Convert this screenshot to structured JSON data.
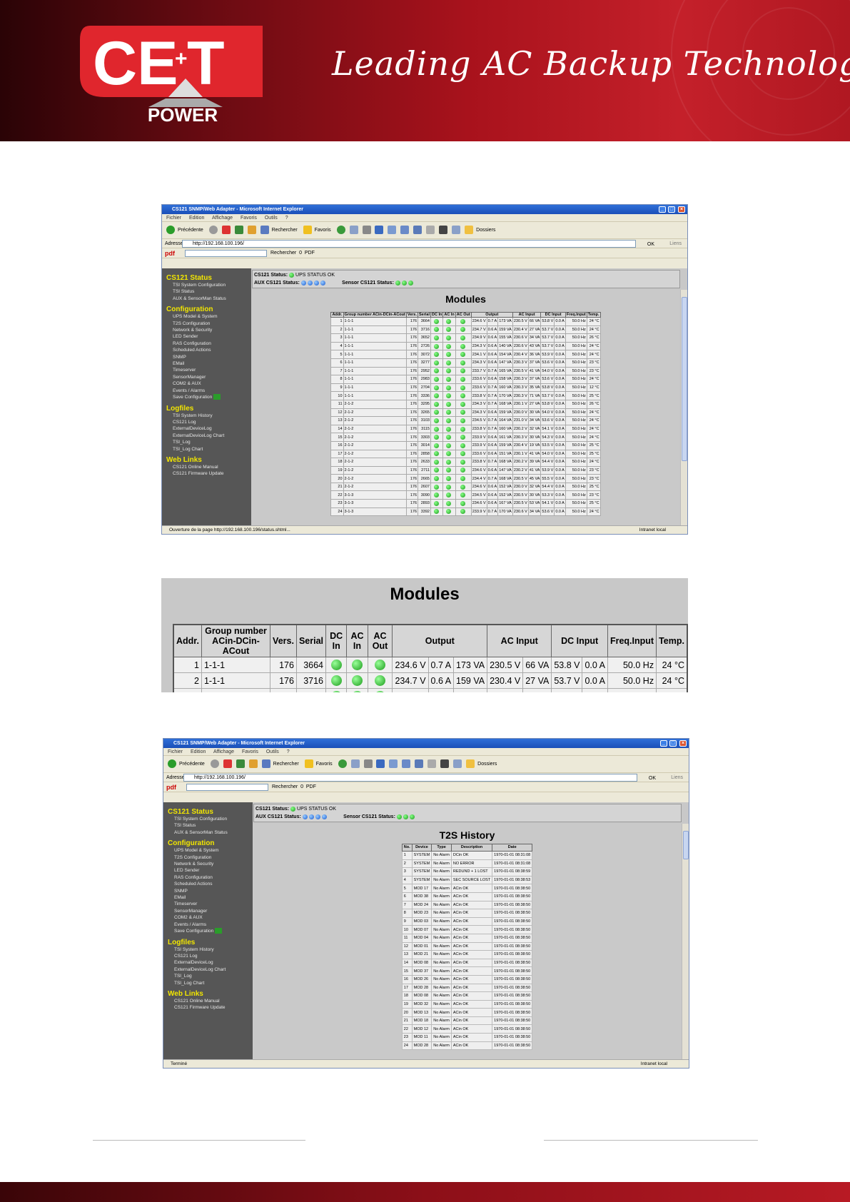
{
  "header": {
    "brand_top": "CE+T",
    "brand_bottom": "POWER",
    "tagline": "Leading AC Backup Technology"
  },
  "browser1": {
    "title": "CS121 SNMP/Web Adapter - Microsoft Internet Explorer",
    "menu": [
      "Fichier",
      "Edition",
      "Affichage",
      "Favoris",
      "Outils",
      "?"
    ],
    "toolbar": {
      "back": "Précédente",
      "search": "Rechercher",
      "favorites": "Favoris",
      "folders": "Dossiers"
    },
    "address_label": "Adresse",
    "address": "http://192.168.100.196/",
    "go": "OK",
    "links": "Liens",
    "pdf_label": "pdf",
    "pdf_search": "Rechercher",
    "pdf_count": "0",
    "pdf_btn": "PDF",
    "status_bar": "Ouverture de la page http://192.168.100.196/status.shtml...",
    "zone": "Intranet local",
    "page_title": "Modules"
  },
  "browser2": {
    "title": "CS121 SNMP/Web Adapter - Microsoft Internet Explorer",
    "address": "http://192.168.100.196/",
    "pdf_count": "0",
    "status_bar": "Terminé",
    "zone": "Intranet local",
    "page_title": "T2S History"
  },
  "cs121_status": {
    "label": "CS121 Status:",
    "value": "UPS STATUS OK",
    "aux_label": "AUX CS121 Status:",
    "sensor_label": "Sensor CS121 Status:"
  },
  "sidebar": {
    "sections": [
      {
        "title": "CS121 Status",
        "items": [
          "TSI System Configuration",
          "TSI Status",
          "AUX & SensorMan Status"
        ]
      },
      {
        "title": "Configuration",
        "items": [
          "UPS Model & System",
          "T2S Configuration",
          "Network & Security",
          "LED Sender",
          "RAS Configuration",
          "Scheduled Actions",
          "SNMP",
          "EMail",
          "Timeserver",
          "SensorManager",
          "COM2 & AUX",
          "Events / Alarms",
          "Save Configuration"
        ]
      },
      {
        "title": "Logfiles",
        "items": [
          "TSI System History",
          "CS121 Log",
          "ExternalDeviceLog",
          "ExternalDeviceLog Chart",
          "TSI_Log",
          "TSI_Log Chart"
        ]
      },
      {
        "title": "Web Links",
        "items": [
          "CS121 Online Manual",
          "CS121 Firmware Update"
        ]
      }
    ]
  },
  "modules": {
    "headers": [
      "Addr.",
      "Group number ACin-DCin-ACout",
      "Vers.",
      "Serial",
      "DC In",
      "AC In",
      "AC Out",
      "Output",
      "AC Input",
      "DC Input",
      "Freq.Input",
      "Temp."
    ],
    "rows": [
      [
        "1",
        "1-1-1",
        "176",
        "3664",
        "234.6 V",
        "0.7 A",
        "173 VA",
        "230.5 V",
        "66 VA",
        "53.8 V",
        "0.0 A",
        "50.0 Hz",
        "24 °C"
      ],
      [
        "2",
        "1-1-1",
        "176",
        "3716",
        "234.7 V",
        "0.6 A",
        "159 VA",
        "230.4 V",
        "27 VA",
        "53.7 V",
        "0.0 A",
        "50.0 Hz",
        "24 °C"
      ],
      [
        "3",
        "1-1-1",
        "176",
        "3652",
        "234.9 V",
        "0.6 A",
        "155 VA",
        "230.6 V",
        "34 VA",
        "53.7 V",
        "0.0 A",
        "50.0 Hz",
        "26 °C"
      ],
      [
        "4",
        "1-1-1",
        "176",
        "2726",
        "234.3 V",
        "0.6 A",
        "140 VA",
        "230.6 V",
        "43 VA",
        "53.7 V",
        "0.0 A",
        "50.0 Hz",
        "24 °C"
      ],
      [
        "5",
        "1-1-1",
        "176",
        "3072",
        "234.1 V",
        "0.6 A",
        "154 VA",
        "230.4 V",
        "36 VA",
        "53.9 V",
        "0.0 A",
        "50.0 Hz",
        "24 °C"
      ],
      [
        "6",
        "1-1-1",
        "176",
        "3277",
        "234.3 V",
        "0.6 A",
        "147 VA",
        "230.3 V",
        "37 VA",
        "53.6 V",
        "0.0 A",
        "50.0 Hz",
        "23 °C"
      ],
      [
        "7",
        "1-1-1",
        "176",
        "2952",
        "233.7 V",
        "0.7 A",
        "165 VA",
        "230.5 V",
        "41 VA",
        "54.0 V",
        "0.0 A",
        "50.0 Hz",
        "23 °C"
      ],
      [
        "8",
        "1-1-1",
        "176",
        "2983",
        "233.6 V",
        "0.6 A",
        "158 VA",
        "230.3 V",
        "37 VA",
        "53.6 V",
        "0.0 A",
        "50.0 Hz",
        "24 °C"
      ],
      [
        "9",
        "1-1-1",
        "176",
        "2704",
        "233.6 V",
        "0.7 A",
        "160 VA",
        "230.3 V",
        "35 VA",
        "53.8 V",
        "0.0 A",
        "50.0 Hz",
        "12 °C"
      ],
      [
        "10",
        "1-1-1",
        "176",
        "3336",
        "233.8 V",
        "0.7 A",
        "170 VA",
        "230.3 V",
        "71 VA",
        "53.7 V",
        "0.0 A",
        "50.0 Hz",
        "25 °C"
      ],
      [
        "11",
        "2-1-2",
        "176",
        "3295",
        "234.3 V",
        "0.7 A",
        "168 VA",
        "230.1 V",
        "27 VA",
        "53.8 V",
        "0.0 A",
        "50.0 Hz",
        "26 °C"
      ],
      [
        "12",
        "2-1-2",
        "176",
        "3265",
        "234.3 V",
        "0.6 A",
        "159 VA",
        "230.0 V",
        "30 VA",
        "54.0 V",
        "0.0 A",
        "50.0 Hz",
        "24 °C"
      ],
      [
        "13",
        "2-1-2",
        "176",
        "3103",
        "234.5 V",
        "0.7 A",
        "164 VA",
        "231.0 V",
        "34 VA",
        "53.6 V",
        "0.0 A",
        "50.0 Hz",
        "24 °C"
      ],
      [
        "14",
        "2-1-2",
        "176",
        "3115",
        "233.8 V",
        "0.7 A",
        "160 VA",
        "230.2 V",
        "32 VA",
        "54.1 V",
        "0.0 A",
        "50.0 Hz",
        "24 °C"
      ],
      [
        "15",
        "2-1-2",
        "176",
        "3303",
        "233.9 V",
        "0.6 A",
        "161 VA",
        "230.3 V",
        "30 VA",
        "54.3 V",
        "0.0 A",
        "50.0 Hz",
        "24 °C"
      ],
      [
        "16",
        "2-1-2",
        "176",
        "3014",
        "233.9 V",
        "0.6 A",
        "159 VA",
        "230.4 V",
        "19 VA",
        "53.5 V",
        "0.0 A",
        "50.0 Hz",
        "25 °C"
      ],
      [
        "17",
        "2-1-2",
        "176",
        "2858",
        "233.6 V",
        "0.6 A",
        "151 VA",
        "230.1 V",
        "41 VA",
        "54.0 V",
        "0.0 A",
        "50.0 Hz",
        "25 °C"
      ],
      [
        "18",
        "2-1-2",
        "176",
        "2633",
        "233.8 V",
        "0.7 A",
        "168 VA",
        "230.2 V",
        "39 VA",
        "54.4 V",
        "0.0 A",
        "50.0 Hz",
        "24 °C"
      ],
      [
        "19",
        "2-1-2",
        "176",
        "2711",
        "234.6 V",
        "0.6 A",
        "147 VA",
        "230.2 V",
        "41 VA",
        "53.9 V",
        "0.0 A",
        "50.0 Hz",
        "23 °C"
      ],
      [
        "20",
        "2-1-2",
        "176",
        "2665",
        "234.4 V",
        "0.7 A",
        "168 VA",
        "230.5 V",
        "45 VA",
        "55.5 V",
        "0.0 A",
        "50.0 Hz",
        "23 °C"
      ],
      [
        "21",
        "2-1-2",
        "176",
        "2607",
        "234.6 V",
        "0.6 A",
        "152 VA",
        "230.0 V",
        "32 VA",
        "54.4 V",
        "0.0 A",
        "50.0 Hz",
        "25 °C"
      ],
      [
        "22",
        "3-1-3",
        "176",
        "3090",
        "234.5 V",
        "0.6 A",
        "152 VA",
        "230.5 V",
        "30 VA",
        "53.3 V",
        "0.0 A",
        "50.0 Hz",
        "23 °C"
      ],
      [
        "23",
        "3-1-3",
        "176",
        "2893",
        "234.6 V",
        "0.6 A",
        "167 VA",
        "230.5 V",
        "53 VA",
        "54.1 V",
        "0.0 A",
        "50.0 Hz",
        "25 °C"
      ],
      [
        "24",
        "3-1-3",
        "176",
        "3392",
        "233.9 V",
        "0.7 A",
        "170 VA",
        "230.6 V",
        "34 VA",
        "53.6 V",
        "0.0 A",
        "50.0 Hz",
        "24 °C"
      ]
    ]
  },
  "history": {
    "headers": [
      "No.",
      "Device",
      "Type",
      "Description",
      "Date"
    ],
    "rows": [
      [
        "1",
        "SYSTEM",
        "No Alarm",
        "DCin OK",
        "1970-01-01 08:31:08"
      ],
      [
        "2",
        "SYSTEM",
        "No Alarm",
        "NO ERROR",
        "1970-01-01 08:31:08"
      ],
      [
        "3",
        "SYSTEM",
        "No Alarm",
        "REDUND + 1 LOST",
        "1970-01-01 08:38:59"
      ],
      [
        "4",
        "SYSTEM",
        "No Alarm",
        "SEC SOURCE LOST",
        "1970-01-01 08:38:53"
      ],
      [
        "5",
        "MOD 17",
        "No Alarm",
        "ACin OK",
        "1970-01-01 08:38:50"
      ],
      [
        "6",
        "MOD 38",
        "No Alarm",
        "ACin OK",
        "1970-01-01 08:38:50"
      ],
      [
        "7",
        "MOD 24",
        "No Alarm",
        "ACin OK",
        "1970-01-01 08:38:50"
      ],
      [
        "8",
        "MOD 23",
        "No Alarm",
        "ACin OK",
        "1970-01-01 08:38:50"
      ],
      [
        "9",
        "MOD 03",
        "No Alarm",
        "ACin OK",
        "1970-01-01 08:38:50"
      ],
      [
        "10",
        "MOD 07",
        "No Alarm",
        "ACin OK",
        "1970-01-01 08:38:50"
      ],
      [
        "11",
        "MOD 04",
        "No Alarm",
        "ACin OK",
        "1970-01-01 08:38:50"
      ],
      [
        "12",
        "MOD 01",
        "No Alarm",
        "ACin OK",
        "1970-01-01 08:38:50"
      ],
      [
        "13",
        "MOD 21",
        "No Alarm",
        "ACin OK",
        "1970-01-01 08:38:50"
      ],
      [
        "14",
        "MOD 08",
        "No Alarm",
        "ACin OK",
        "1970-01-01 08:38:50"
      ],
      [
        "15",
        "MOD 37",
        "No Alarm",
        "ACin OK",
        "1970-01-01 08:38:50"
      ],
      [
        "16",
        "MOD 26",
        "No Alarm",
        "ACin OK",
        "1970-01-01 08:38:50"
      ],
      [
        "17",
        "MOD 28",
        "No Alarm",
        "ACin OK",
        "1970-01-01 08:38:50"
      ],
      [
        "18",
        "MOD 08",
        "No Alarm",
        "ACin OK",
        "1970-01-01 08:38:50"
      ],
      [
        "19",
        "MOD 32",
        "No Alarm",
        "ACin OK",
        "1970-01-01 08:38:50"
      ],
      [
        "20",
        "MOD 13",
        "No Alarm",
        "ACin OK",
        "1970-01-01 08:38:50"
      ],
      [
        "21",
        "MOD 18",
        "No Alarm",
        "ACin OK",
        "1970-01-01 08:38:50"
      ],
      [
        "22",
        "MOD 12",
        "No Alarm",
        "ACin OK",
        "1970-01-01 08:38:50"
      ],
      [
        "23",
        "MOD 11",
        "No Alarm",
        "ACin OK",
        "1970-01-01 08:38:50"
      ],
      [
        "24",
        "MOD 28",
        "No Alarm",
        "ACin OK",
        "1970-01-01 08:38:50"
      ]
    ]
  },
  "colors": {
    "accent": "#c4202a",
    "brand_dark": "#2a0306",
    "sidebar_heading": "#f2e600",
    "led_green": "#1a9a1a",
    "led_blue": "#1a5ad0"
  }
}
